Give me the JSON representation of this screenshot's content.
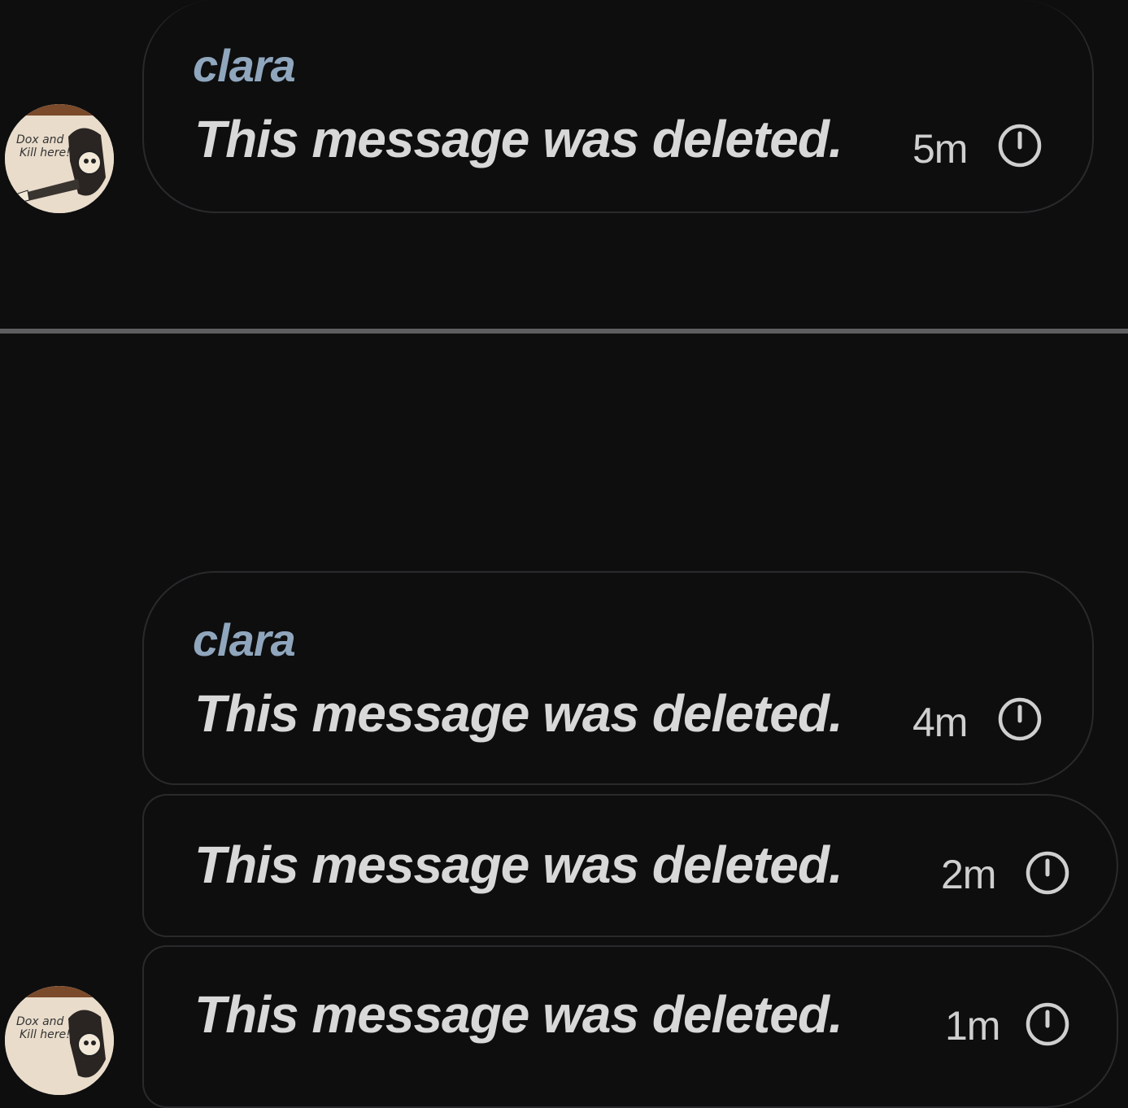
{
  "messages": [
    {
      "author": "clara",
      "text": "This message was deleted.",
      "time": "5m"
    },
    {
      "author": "clara",
      "text": "This message was deleted.",
      "time": "4m"
    },
    {
      "author": "",
      "text": "This message was deleted.",
      "time": "2m"
    },
    {
      "author": "",
      "text": "This message was deleted.",
      "time": "1m"
    }
  ],
  "avatar_text": "Dox and Kill here!",
  "colors": {
    "background": "#0e0e0f",
    "bubble_border": "#2a2a2c",
    "author": "#8fa6bd",
    "message_text": "#d8d8d8",
    "divider": "#5e5e60"
  },
  "icons": {
    "timer": "clock-icon",
    "avatar": "user-avatar"
  }
}
